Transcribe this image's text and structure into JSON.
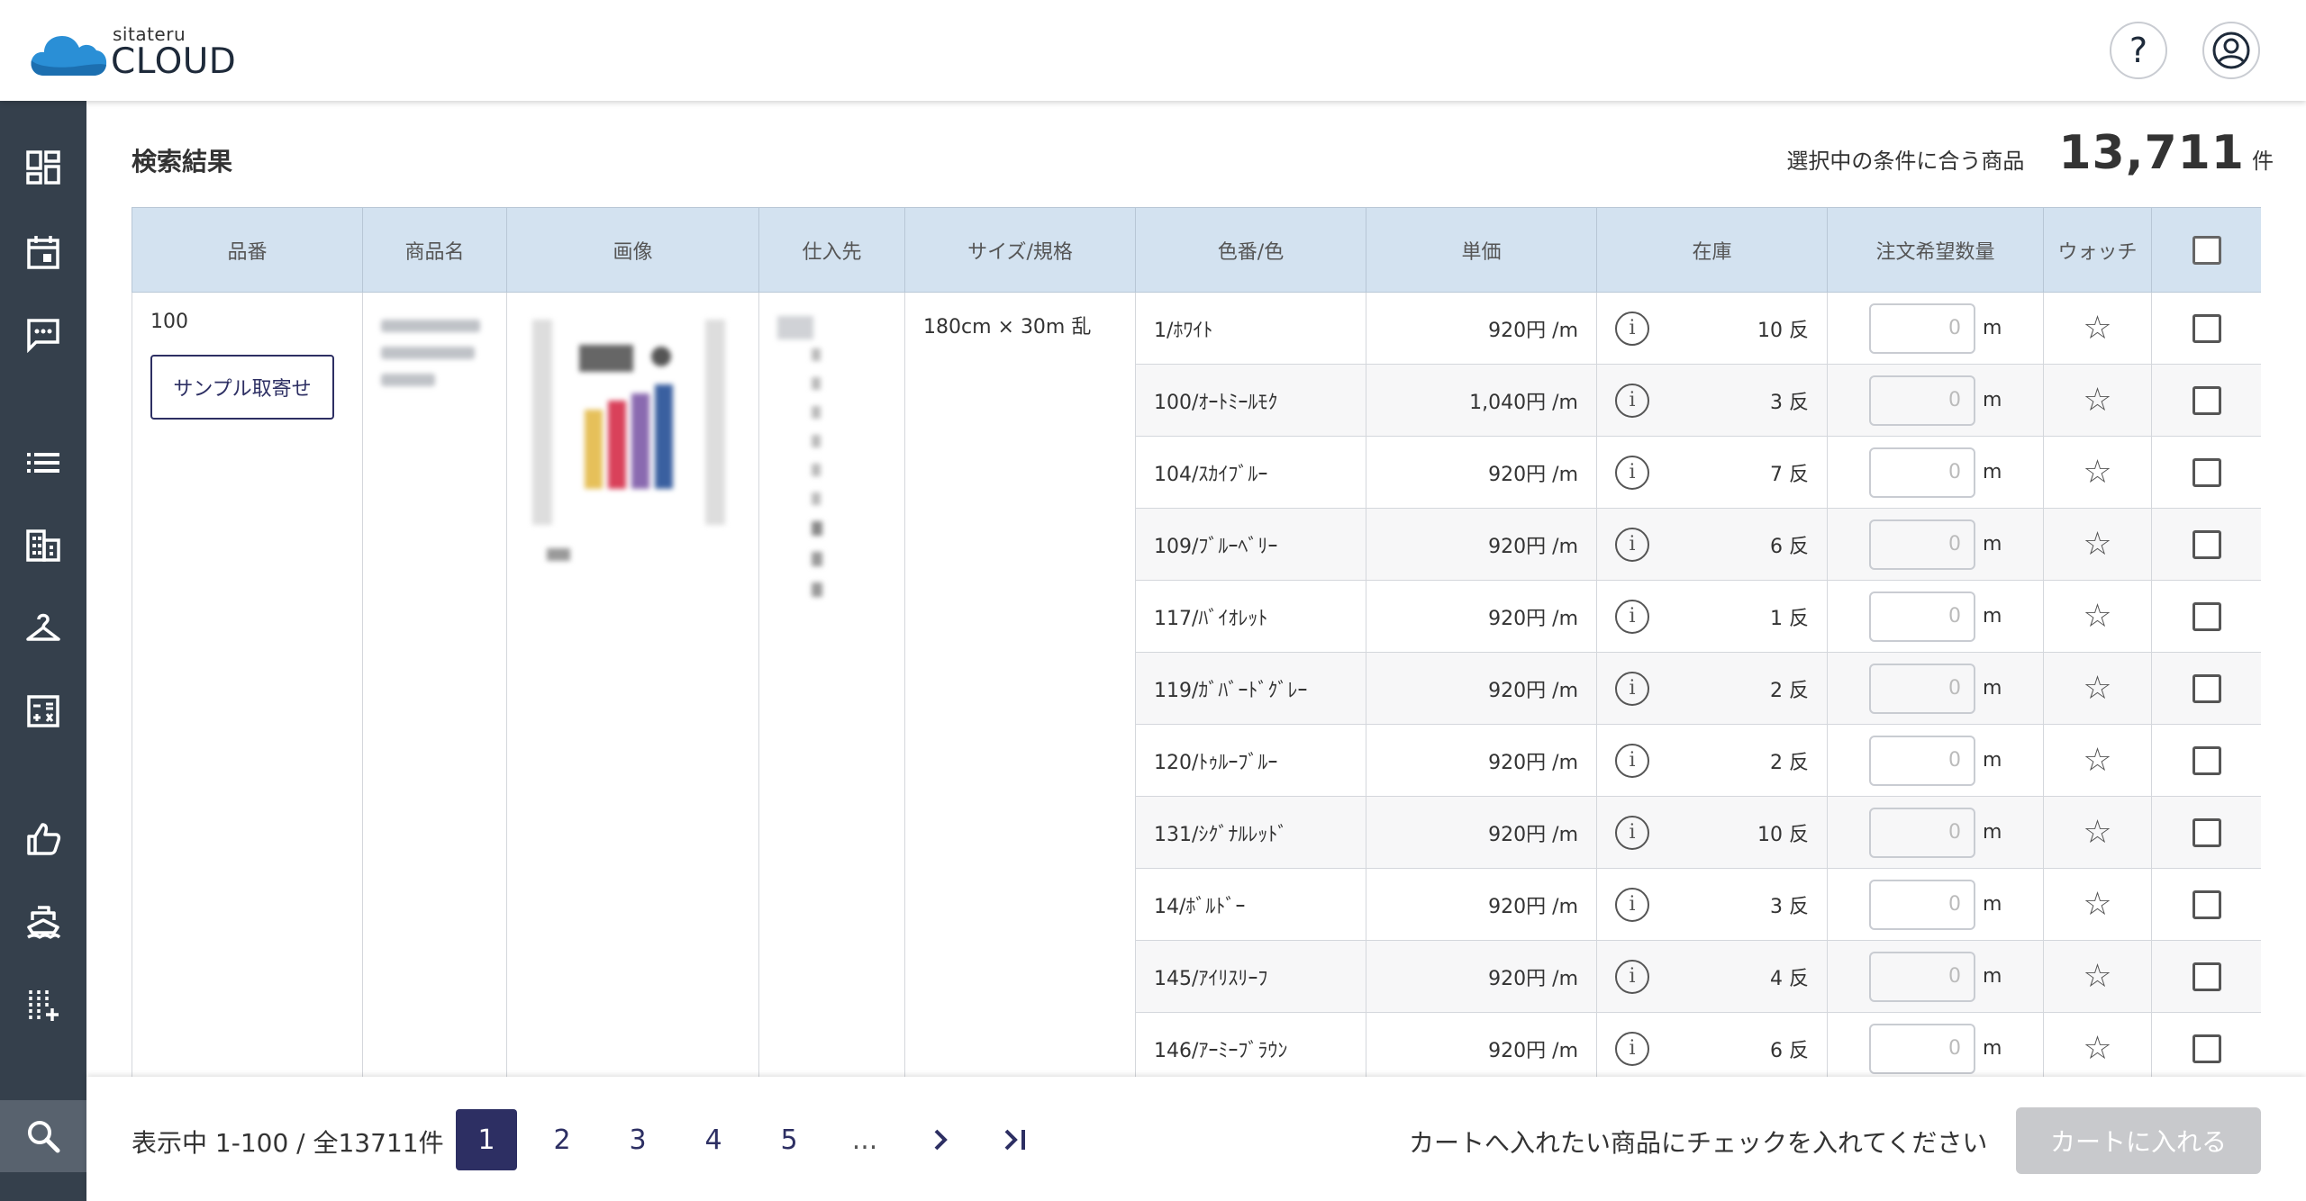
{
  "header": {
    "logo_small": "sitateru",
    "logo_big": "CLOUD",
    "help_label": "?",
    "brand_color": "#2a8fd6"
  },
  "sidebar": {
    "items": [
      {
        "icon": "dashboard-icon"
      },
      {
        "icon": "calendar-icon"
      },
      {
        "icon": "chat-icon"
      },
      {
        "icon": "list-icon"
      },
      {
        "icon": "building-icon"
      },
      {
        "icon": "hanger-icon"
      },
      {
        "icon": "calculator-icon"
      },
      {
        "icon": "thumbs-up-icon"
      },
      {
        "icon": "ship-icon"
      },
      {
        "icon": "add-column-icon"
      },
      {
        "icon": "search-icon",
        "active": true
      }
    ]
  },
  "main": {
    "title": "検索結果",
    "count_label": "選択中の条件に合う商品",
    "count_value": "13,711",
    "count_unit": "件"
  },
  "table": {
    "headers": [
      "品番",
      "商品名",
      "画像",
      "仕入先",
      "サイズ/規格",
      "色番/色",
      "単価",
      "在庫",
      "注文希望数量",
      "ウォッチ"
    ],
    "product": {
      "number": "100",
      "sample_button": "サンプル取寄せ",
      "size": "180cm × 30m 乱"
    },
    "rows": [
      {
        "color": "1/ﾎﾜｲﾄ",
        "price": "920円 /m",
        "stock": "10 反",
        "qty": "0",
        "unit": "m"
      },
      {
        "color": "100/ｵｰﾄﾐｰﾙﾓｸ",
        "price": "1,040円 /m",
        "stock": "3 反",
        "qty": "0",
        "unit": "m"
      },
      {
        "color": "104/ｽｶｲﾌﾞﾙｰ",
        "price": "920円 /m",
        "stock": "7 反",
        "qty": "0",
        "unit": "m"
      },
      {
        "color": "109/ﾌﾞﾙｰﾍﾞﾘｰ",
        "price": "920円 /m",
        "stock": "6 反",
        "qty": "0",
        "unit": "m"
      },
      {
        "color": "117/ﾊﾞｲｵﾚｯﾄ",
        "price": "920円 /m",
        "stock": "1 反",
        "qty": "0",
        "unit": "m"
      },
      {
        "color": "119/ｶﾞﾊﾞｰﾄﾞｸﾞﾚｰ",
        "price": "920円 /m",
        "stock": "2 反",
        "qty": "0",
        "unit": "m"
      },
      {
        "color": "120/ﾄｩﾙｰﾌﾞﾙｰ",
        "price": "920円 /m",
        "stock": "2 反",
        "qty": "0",
        "unit": "m"
      },
      {
        "color": "131/ｼｸﾞﾅﾙﾚｯﾄﾞ",
        "price": "920円 /m",
        "stock": "10 反",
        "qty": "0",
        "unit": "m"
      },
      {
        "color": "14/ﾎﾞﾙﾄﾞｰ",
        "price": "920円 /m",
        "stock": "3 反",
        "qty": "0",
        "unit": "m"
      },
      {
        "color": "145/ｱｲﾘｽﾘｰﾌ",
        "price": "920円 /m",
        "stock": "4 反",
        "qty": "0",
        "unit": "m"
      },
      {
        "color": "146/ｱｰﾐｰﾌﾞﾗｳﾝ",
        "price": "920円 /m",
        "stock": "6 反",
        "qty": "0",
        "unit": "m"
      }
    ]
  },
  "footer": {
    "showing": "表示中 1-100 / 全13711件",
    "pages": [
      "1",
      "2",
      "3",
      "4",
      "5"
    ],
    "ellipsis": "...",
    "next": "›",
    "last": "›|",
    "message": "カートへ入れたい商品にチェックを入れてください",
    "cart_button": "カートに入れる"
  }
}
